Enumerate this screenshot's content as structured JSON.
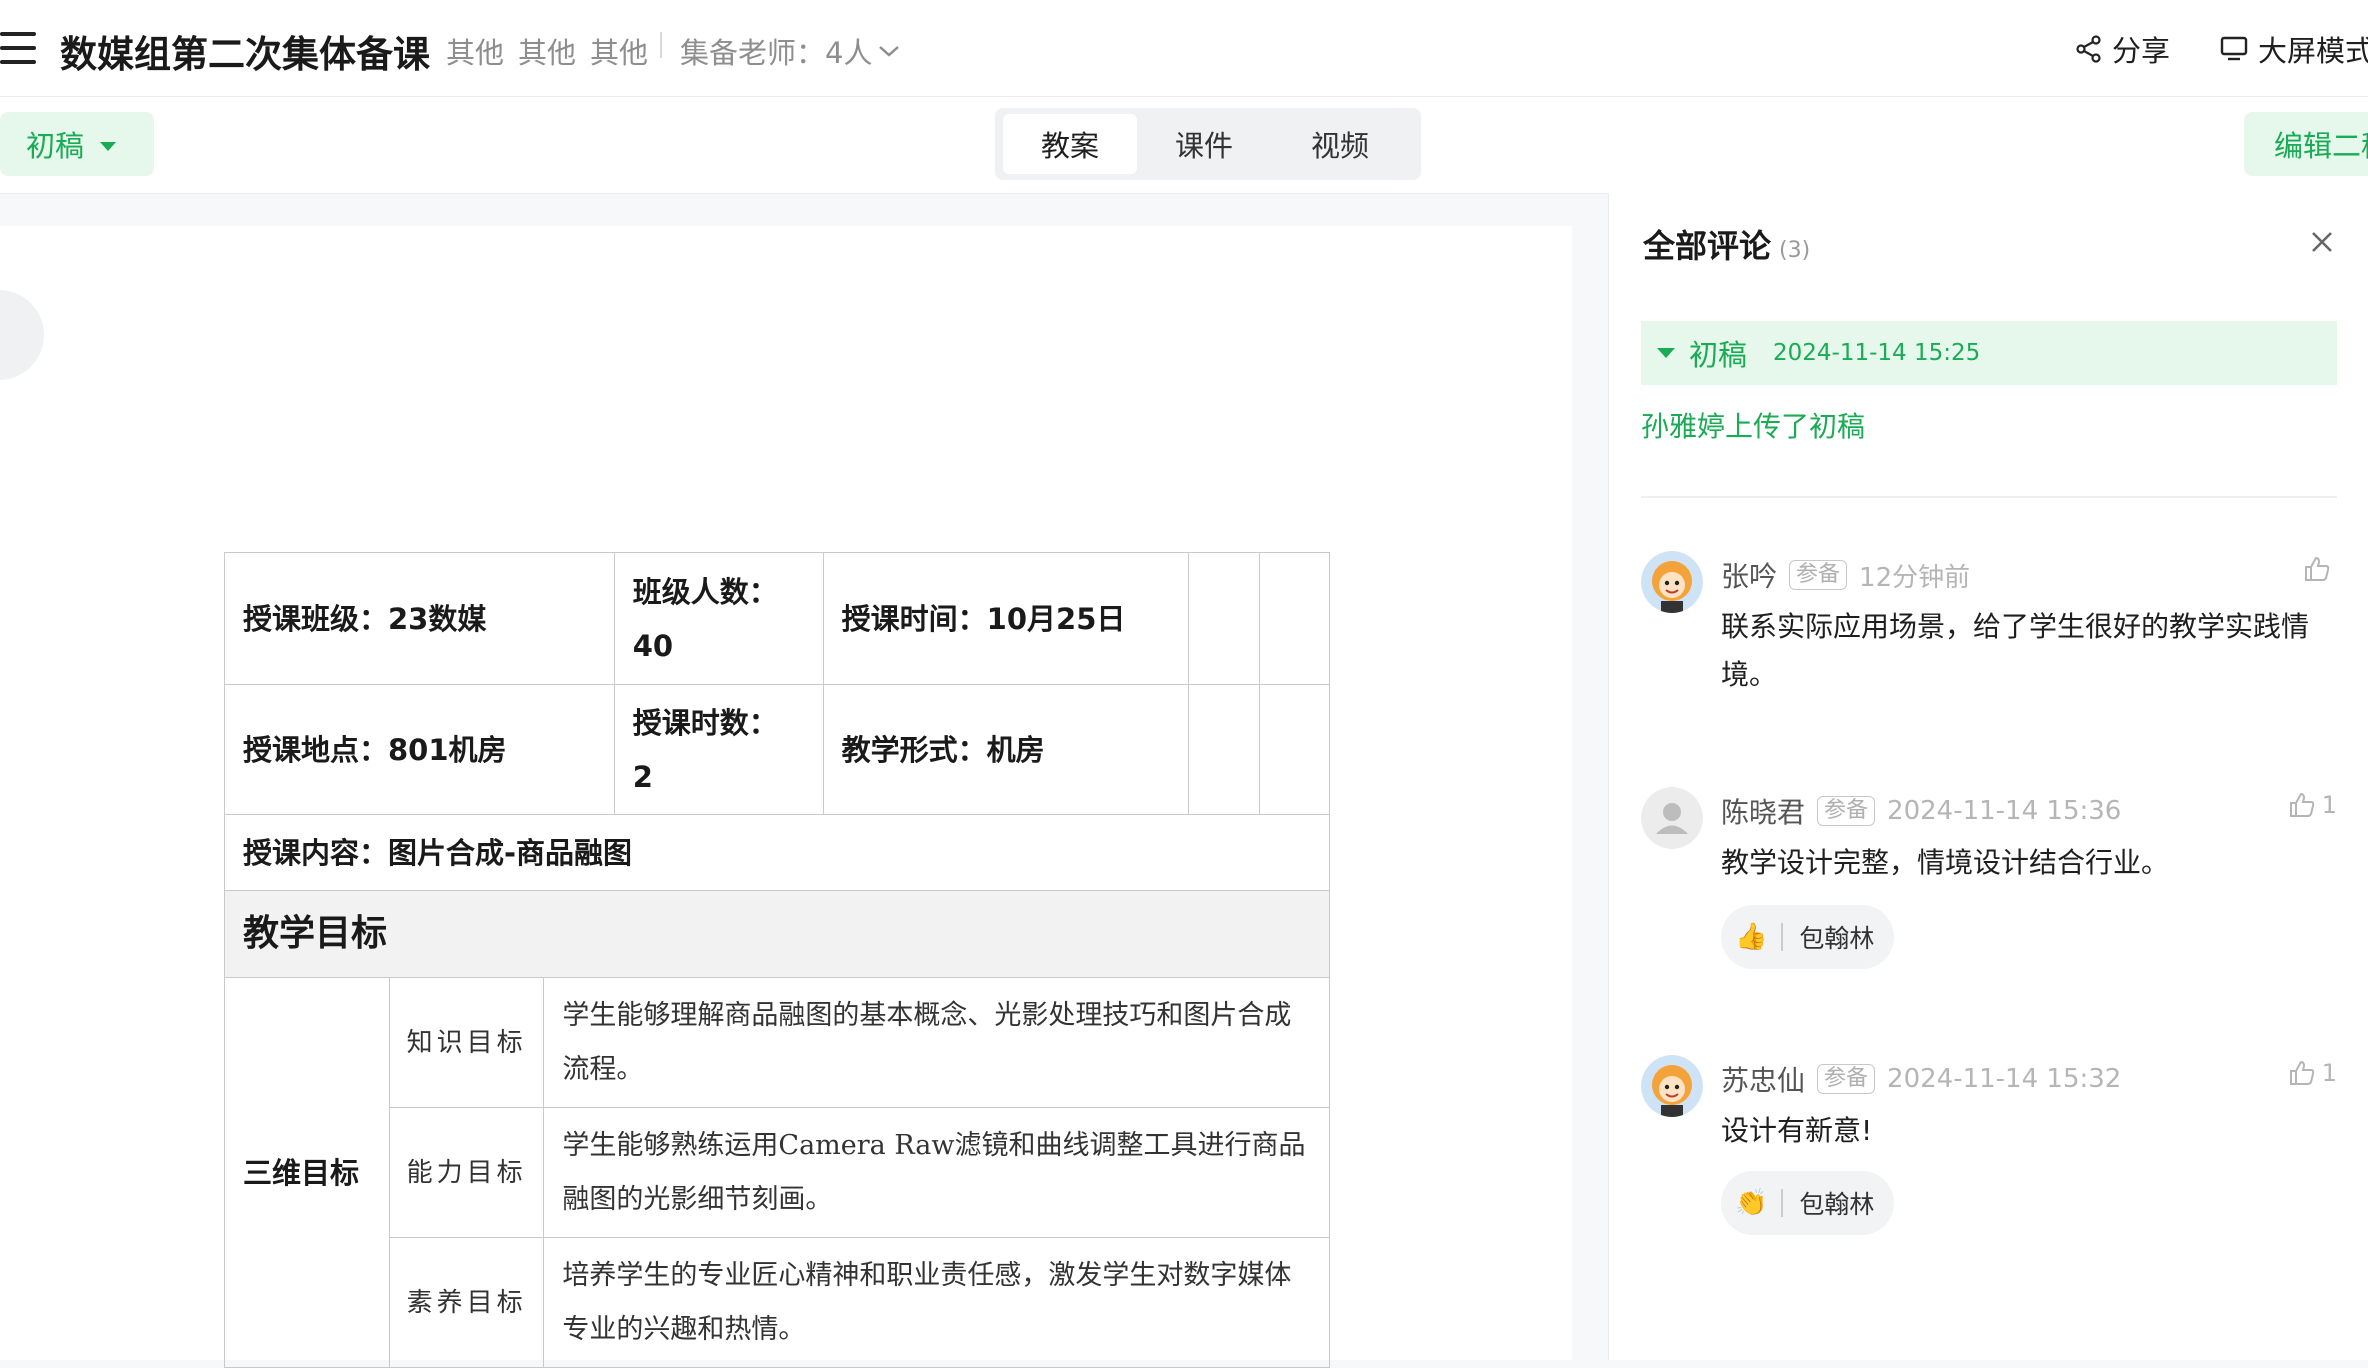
{
  "header": {
    "title": "数媒组第二次集体备课",
    "tags": [
      "其他",
      "其他",
      "其他"
    ],
    "teachers": "集备老师：4人",
    "share": "分享",
    "fullscreen": "大屏模式"
  },
  "toolbar": {
    "draft": "初稿",
    "tabs": [
      {
        "label": "教案",
        "active": true
      },
      {
        "label": "课件",
        "active": false
      },
      {
        "label": "视频",
        "active": false
      }
    ],
    "edit": "编辑二稿"
  },
  "lesson": {
    "row1": {
      "class": "授课班级：23数媒",
      "size_label": "班级人数：",
      "size_value": "40",
      "time": "授课时间：10月25日"
    },
    "row2": {
      "place": "授课地点：801机房",
      "hours_label": "授课时数：",
      "hours_value": "2",
      "form": "教学形式：机房"
    },
    "content": "授课内容：图片合成-商品融图",
    "section": "教学目标",
    "goals_label": "三维目标",
    "goals": [
      {
        "name": "知识目标",
        "desc": "学生能够理解商品融图的基本概念、光影处理技巧和图片合成流程。"
      },
      {
        "name": "能力目标",
        "desc": "学生能够熟练运用Camera Raw滤镜和曲线调整工具进行商品融图的光影细节刻画。"
      },
      {
        "name": "素养目标",
        "desc": "培养学生的专业匠心精神和职业责任感，激发学生对数字媒体专业的兴趣和热情。"
      }
    ]
  },
  "comments_panel": {
    "title": "全部评论",
    "count": "(3)",
    "version": "初稿",
    "version_time": "2024-11-14 15:25",
    "upload_note": "孙雅婷上传了初稿",
    "comments": [
      {
        "name": "张吟",
        "badge": "参备",
        "time": "12分钟前",
        "text": "联系实际应用场景，给了学生很好的教学实践情境。",
        "likes": "",
        "avatar": "cartoon-avatar-icon"
      },
      {
        "name": "陈晓君",
        "badge": "参备",
        "time": "2024-11-14 15:36",
        "text": "教学设计完整，情境设计结合行业。",
        "likes": "1",
        "avatar": "default-user-icon",
        "reaction": {
          "emoji": "👍",
          "user": "包翰林"
        }
      },
      {
        "name": "苏忠仙",
        "badge": "参备",
        "time": "2024-11-14 15:32",
        "text": "设计有新意!",
        "likes": "1",
        "avatar": "cartoon-avatar-icon",
        "reaction": {
          "emoji": "👏",
          "user": "包翰林"
        }
      }
    ]
  },
  "colors": {
    "accent": "#1aab55",
    "accent_bg": "#e6f7ec",
    "muted": "#8e8e8e"
  }
}
